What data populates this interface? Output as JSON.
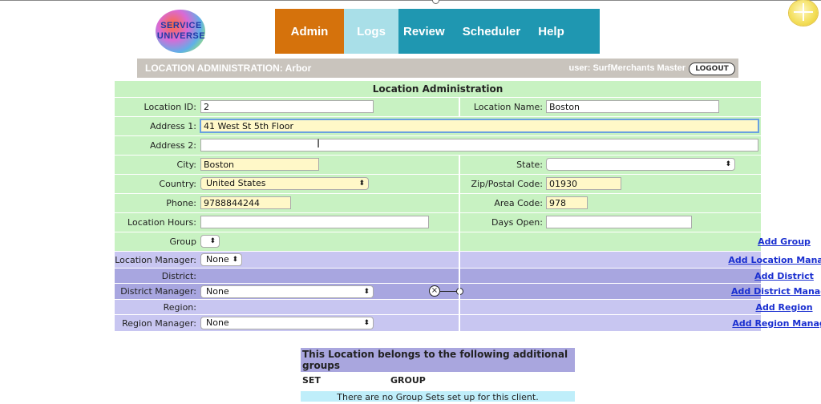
{
  "logo": {
    "line1": "SERVICE",
    "line2": "UNIVERSE"
  },
  "nav": {
    "items": [
      "Admin",
      "Logs",
      "Review",
      "Scheduler",
      "Help"
    ]
  },
  "header": {
    "title": "LOCATION ADMINISTRATION: Arbor",
    "user": "user: SurfMerchants Master",
    "logout": "LOGOUT"
  },
  "form": {
    "title": "Location Administration",
    "location_id_label": "Location ID:",
    "location_id": "2",
    "location_name_label": "Location Name:",
    "location_name": "Boston",
    "address1_label": "Address 1:",
    "address1": "41 West St 5th Floor",
    "address2_label": "Address 2:",
    "address2": "",
    "city_label": "City:",
    "city": "Boston",
    "state_label": "State:",
    "state": "",
    "country_label": "Country:",
    "country": "United States",
    "zip_label": "Zip/Postal Code:",
    "zip": "01930",
    "phone_label": "Phone:",
    "phone": "9788844244",
    "area_code_label": "Area Code:",
    "area_code": "978",
    "hours_label": "Location Hours:",
    "hours": "",
    "days_open_label": "Days Open:",
    "days_open": "",
    "group_label": "Group",
    "group": "",
    "add_group": "Add Group",
    "location_manager_label": "Location Manager:",
    "location_manager": "None",
    "add_location_manager": "Add Location Manager",
    "district_label": "District:",
    "add_district": "Add District",
    "district_manager_label": "District Manager:",
    "district_manager": "None",
    "add_district_manager": "Add District Manager",
    "region_label": "Region:",
    "add_region": "Add Region",
    "region_manager_label": "Region Manager:",
    "region_manager": "None",
    "add_region_manager": "Add Region Manager"
  },
  "groups": {
    "heading": "This Location belongs to the following additional groups",
    "col_set": "SET",
    "col_group": "GROUP",
    "empty": "There are no Group Sets set up for this client."
  },
  "colors": {
    "admin_tab": "#d5720c",
    "nav_bg": "#1f97b1",
    "form_green": "#c8f2c2",
    "form_lavender": "#c8c6f1",
    "link": "#1a2fd0"
  }
}
